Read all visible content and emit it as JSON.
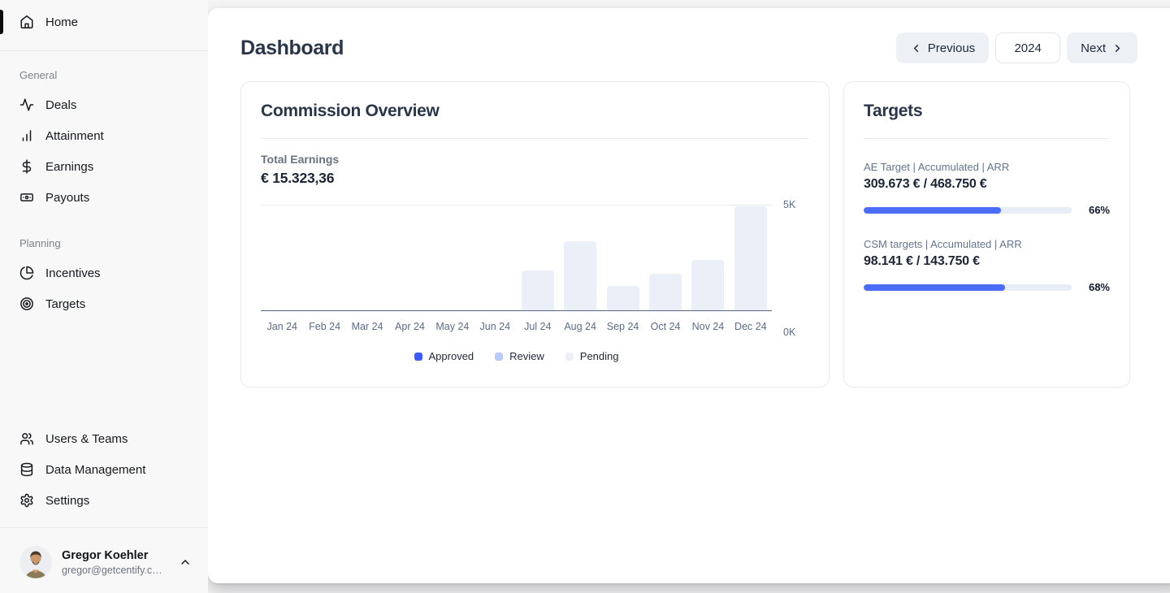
{
  "colors": {
    "approved": "#3d5cf5",
    "review": "#bcc9fb",
    "pending": "#ebeff7",
    "progress": "#4a6cf6"
  },
  "sidebar": {
    "home": {
      "label": "Home"
    },
    "sections": [
      {
        "label": "General",
        "items": [
          {
            "label": "Deals",
            "icon": "activity-icon"
          },
          {
            "label": "Attainment",
            "icon": "bar-chart-icon"
          },
          {
            "label": "Earnings",
            "icon": "dollar-icon"
          },
          {
            "label": "Payouts",
            "icon": "banknote-icon"
          }
        ]
      },
      {
        "label": "Planning",
        "items": [
          {
            "label": "Incentives",
            "icon": "pie-chart-icon"
          },
          {
            "label": "Targets",
            "icon": "target-icon"
          }
        ]
      }
    ],
    "footer_items": [
      {
        "label": "Users & Teams",
        "icon": "users-icon"
      },
      {
        "label": "Data Management",
        "icon": "database-icon"
      },
      {
        "label": "Settings",
        "icon": "gear-icon"
      }
    ],
    "profile": {
      "name": "Gregor Koehler",
      "email": "gregor@getcentify.c…"
    }
  },
  "header": {
    "title": "Dashboard",
    "previous_label": "Previous",
    "year": "2024",
    "next_label": "Next"
  },
  "commission": {
    "title": "Commission Overview",
    "total_earnings_label": "Total Earnings",
    "total_earnings_value": "€ 15.323,36"
  },
  "targets_card": {
    "title": "Targets",
    "items": [
      {
        "label": "AE Target | Accumulated | ARR",
        "value": "309.673 € / 468.750 €",
        "percent": 66,
        "percent_label": "66%"
      },
      {
        "label": "CSM targets | Accumulated | ARR",
        "value": "98.141 € / 143.750 €",
        "percent": 68,
        "percent_label": "68%"
      }
    ]
  },
  "chart_data": {
    "type": "bar",
    "title": "Commission Overview",
    "categories": [
      "Jan 24",
      "Feb 24",
      "Mar 24",
      "Apr 24",
      "May 24",
      "Jun 24",
      "Jul 24",
      "Aug 24",
      "Sep 24",
      "Oct 24",
      "Nov 24",
      "Dec 24"
    ],
    "series": [
      {
        "name": "Approved",
        "color": "#3d5cf5",
        "values": [
          0,
          0,
          0,
          0,
          0,
          0,
          0,
          0,
          0,
          0,
          0,
          0
        ]
      },
      {
        "name": "Review",
        "color": "#bcc9fb",
        "values": [
          0,
          0,
          0,
          0,
          0,
          0,
          0,
          0,
          0,
          0,
          0,
          0
        ]
      },
      {
        "name": "Pending",
        "color": "#ebeff7",
        "values": [
          0,
          0,
          0,
          0,
          0,
          0,
          1870,
          3240,
          1150,
          1720,
          2370,
          4890
        ]
      }
    ],
    "stacked": true,
    "ylim": [
      0,
      5000
    ],
    "yticks": [
      "5K",
      "0K"
    ],
    "ytick_side": "right",
    "grid": "top-line-only",
    "legend_position": "bottom"
  }
}
